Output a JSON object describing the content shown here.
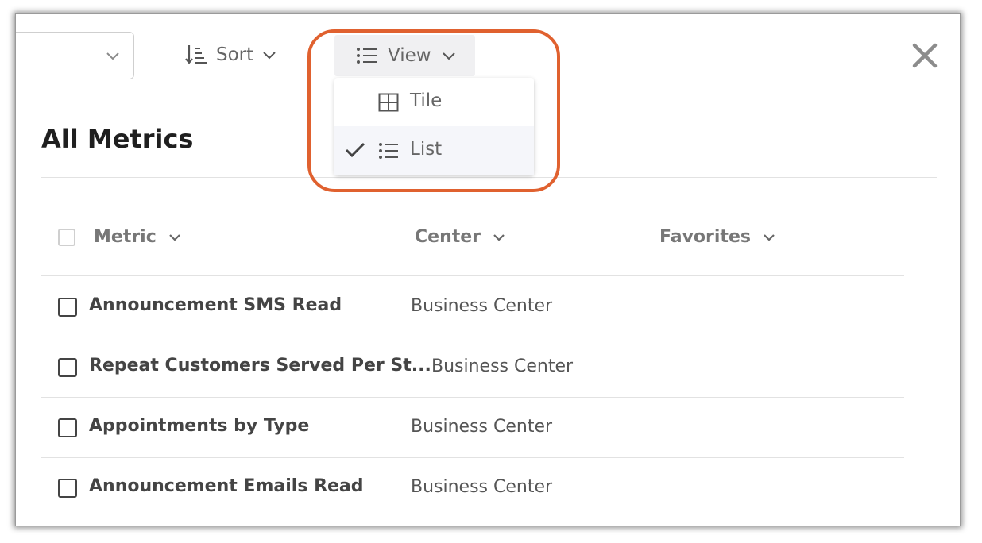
{
  "toolbar": {
    "sort_label": "Sort",
    "view_label": "View",
    "close_icon": "close-icon"
  },
  "view_menu": {
    "items": [
      {
        "label": "Tile",
        "icon": "grid-icon",
        "selected": false
      },
      {
        "label": "List",
        "icon": "list-icon",
        "selected": true
      }
    ]
  },
  "page": {
    "title": "All Metrics"
  },
  "table": {
    "columns": [
      "Metric",
      "Center",
      "Favorites"
    ],
    "rows": [
      {
        "metric": "Announcement SMS Read",
        "center": "Business Center"
      },
      {
        "metric": "Repeat Customers Served Per St...",
        "center": "Business Center"
      },
      {
        "metric": "Appointments by Type",
        "center": "Business Center"
      },
      {
        "metric": "Announcement Emails Read",
        "center": "Business Center"
      }
    ]
  },
  "colors": {
    "highlight": "#e0612f",
    "view_button_bg": "#f0f0f2",
    "selected_item_bg": "#f5f6fa"
  }
}
